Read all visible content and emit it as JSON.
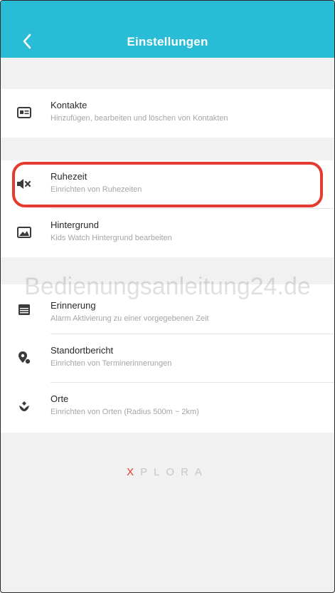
{
  "header": {
    "title": "Einstellungen"
  },
  "group1": [
    {
      "title": "Kontakte",
      "subtitle": "Hinzufügen, bearbeiten und löschen von Kontakten",
      "icon": "contact-card-icon"
    }
  ],
  "group2": [
    {
      "title": "Ruhezeit",
      "subtitle": "Einrichten von Ruhezeiten",
      "icon": "speaker-mute-icon"
    },
    {
      "title": "Hintergrund",
      "subtitle": "Kids Watch Hintergrund bearbeiten",
      "icon": "image-icon"
    }
  ],
  "watermark": "Bedienungsanleitung24.de",
  "group3": [
    {
      "title": "Erinnerung",
      "subtitle": "Alarm Aktivierung zu einer vorgegebenen Zeit",
      "icon": "calendar-icon"
    },
    {
      "title": "Standortbericht",
      "subtitle": "Einrichten von Terminerinnerungen",
      "icon": "location-report-icon"
    },
    {
      "title": "Orte",
      "subtitle": "Einrichten von Orten (Radius 500m ~ 2km)",
      "icon": "places-icon"
    }
  ],
  "brand": {
    "x": "X",
    "rest": "PLORA"
  },
  "colors": {
    "header": "#29bcd6",
    "highlight": "#e53a2e",
    "brand_accent": "#e53a2e"
  }
}
